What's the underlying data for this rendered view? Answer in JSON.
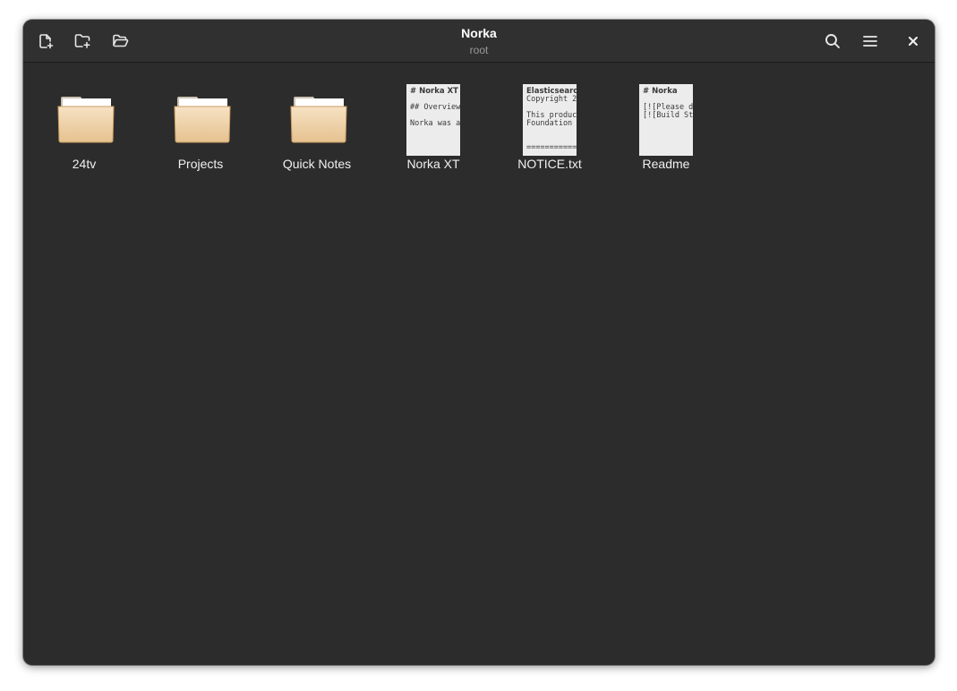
{
  "window": {
    "title": "Norka",
    "subtitle": "root"
  },
  "toolbar": {
    "left_icons": [
      "new-document-icon",
      "new-folder-icon",
      "open-folder-icon"
    ],
    "right_icons": [
      "search-icon",
      "menu-icon",
      "close-icon"
    ]
  },
  "items": [
    {
      "type": "folder",
      "label": "24tv"
    },
    {
      "type": "folder",
      "label": "Projects"
    },
    {
      "type": "folder",
      "label": "Quick Notes"
    },
    {
      "type": "document",
      "label": "Norka XT",
      "preview": [
        "# Norka XT",
        "",
        "## Overview",
        "",
        "Norka was a"
      ]
    },
    {
      "type": "document",
      "label": "NOTICE.txt",
      "preview": [
        "Elasticsearch",
        "Copyright 2",
        "",
        "This product",
        "Foundation",
        "",
        "",
        "=============="
      ]
    },
    {
      "type": "document",
      "label": "Readme",
      "preview": [
        "# Norka",
        "",
        "[![Please d",
        "[![Build St"
      ]
    }
  ],
  "colors": {
    "window_bg": "#2c2c2c",
    "headerbar_bg": "#303030",
    "text": "#f0f0f0",
    "subtitle": "#9a9a9a",
    "folder_front": "#e9c89a",
    "document_bg": "#ececec"
  }
}
